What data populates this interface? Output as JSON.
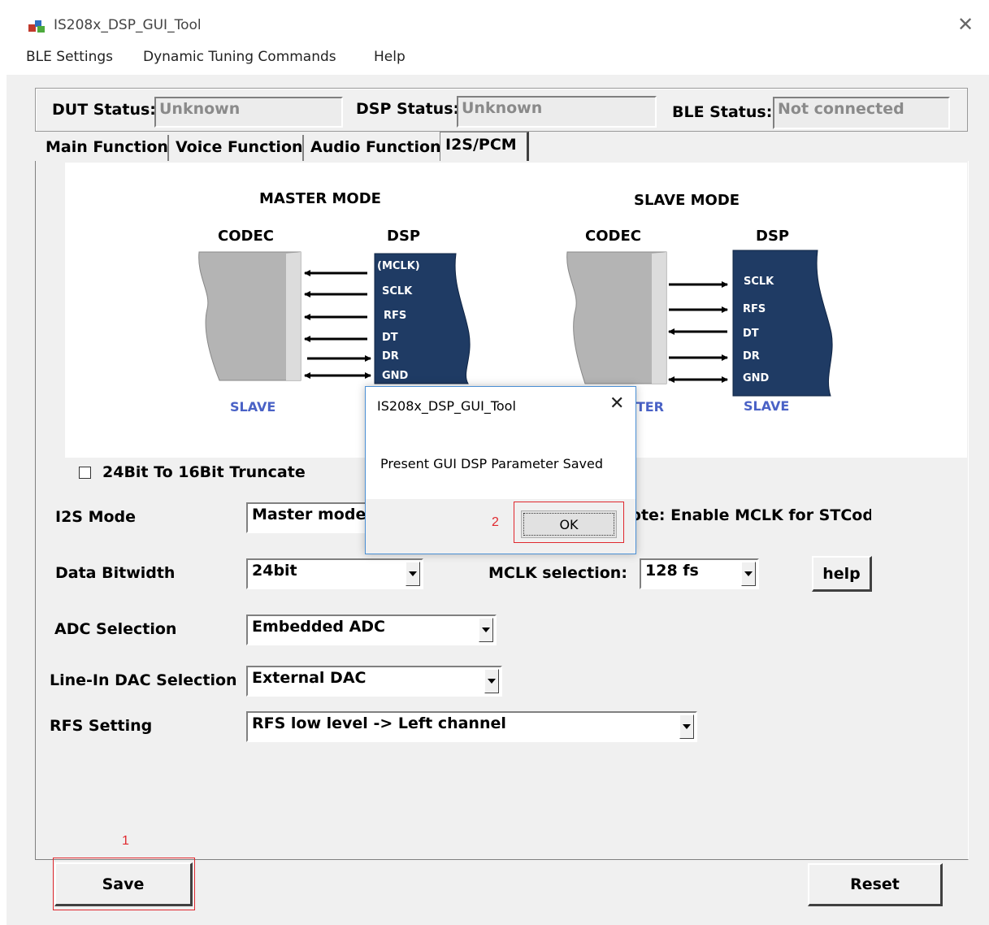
{
  "window": {
    "title": "IS208x_DSP_GUI_Tool"
  },
  "menu": [
    "BLE Settings",
    "Dynamic Tuning Commands",
    "Help"
  ],
  "status": {
    "dut_label": "DUT Status:",
    "dut_value": "Unknown",
    "dsp_label": "DSP Status:",
    "dsp_value": "Unknown",
    "ble_label": "BLE Status:",
    "ble_value": "Not connected"
  },
  "tabs": [
    "Main Function",
    "Voice Function",
    "Audio Function",
    "I2S/PCM"
  ],
  "diagram": {
    "master": {
      "title": "MASTER MODE",
      "codec_label": "CODEC",
      "dsp_label": "DSP",
      "codec_role": "SLAVE",
      "signals": [
        "(MCLK)",
        "SCLK",
        "RFS",
        "DT",
        "DR",
        "GND"
      ]
    },
    "slave": {
      "title": "SLAVE MODE",
      "codec_label": "CODEC",
      "dsp_label": "DSP",
      "codec_role": "MASTER",
      "dsp_role": "SLAVE",
      "signals": [
        "SCLK",
        "RFS",
        "DT",
        "DR",
        "GND"
      ]
    }
  },
  "truncate_checkbox": {
    "label": "24Bit To 16Bit Truncate",
    "checked": false
  },
  "form": {
    "i2s_mode": {
      "label": "I2S Mode",
      "value": "Master mode"
    },
    "mclk_note": "Note: Enable MCLK for STCodec",
    "data_bitwidth": {
      "label": "Data Bitwidth",
      "value": "24bit"
    },
    "mclk_selection": {
      "label": "MCLK selection:",
      "value": "128 fs"
    },
    "help_button": "help",
    "adc_selection": {
      "label": "ADC Selection",
      "value": "Embedded ADC"
    },
    "linein_dac": {
      "label": "Line-In DAC Selection",
      "value": "External DAC"
    },
    "rfs_setting": {
      "label": "RFS Setting",
      "value": "RFS low level -> Left channel"
    }
  },
  "buttons": {
    "save": "Save",
    "reset": "Reset"
  },
  "annotations": {
    "step1": "1",
    "step2": "2"
  },
  "dialog": {
    "title": "IS208x_DSP_GUI_Tool",
    "message": "Present GUI DSP Parameter Saved",
    "ok": "OK"
  },
  "colors": {
    "dsp_block": "#1f3b64",
    "codec_block": "#b4b4b4",
    "role_label": "#4a62c6",
    "annotation": "#e0282e",
    "dialog_border": "#4a8fd4"
  }
}
